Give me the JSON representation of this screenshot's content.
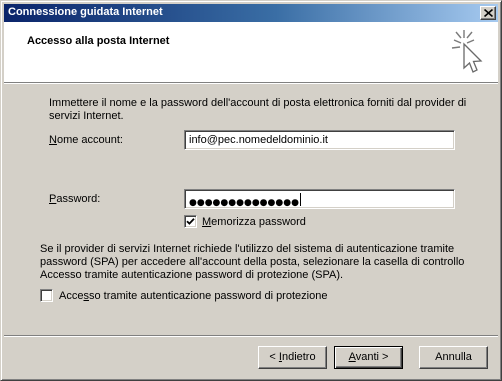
{
  "window": {
    "title": "Connessione guidata Internet",
    "close_label": "×"
  },
  "header": {
    "title": "Accesso alla posta Internet",
    "icon": "wizard-sparkle-cursor-icon"
  },
  "form": {
    "intro": "Immettere il nome e la password dell'account di posta elettronica forniti dal provider di servizi Internet.",
    "account_label_u": "N",
    "account_label_rest": "ome account:",
    "account_value": "info@pec.nomedeldominio.it",
    "password_label_u": "P",
    "password_label_rest": "assword:",
    "password_mask": "●●●●●●●●●●●●●●",
    "remember_label_u": "M",
    "remember_label_rest": "emorizza password",
    "remember_checked": true,
    "spa_text": "Se il provider di servizi Internet richiede l'utilizzo del sistema di autenticazione tramite password (SPA) per accedere all'account della posta, selezionare la casella di controllo Accesso tramite autenticazione password di protezione (SPA).",
    "spa_label_pre": "Acce",
    "spa_label_u": "s",
    "spa_label_rest": "so tramite autenticazione password di protezione",
    "spa_checked": false
  },
  "buttons": {
    "back_pre": "< ",
    "back_u": "I",
    "back_rest": "ndietro",
    "next_u": "A",
    "next_rest": "vanti >",
    "cancel": "Annulla"
  },
  "colors": {
    "titlebar_start": "#0a246a",
    "titlebar_end": "#a6caf0",
    "dialog_face": "#d4d0c8"
  }
}
